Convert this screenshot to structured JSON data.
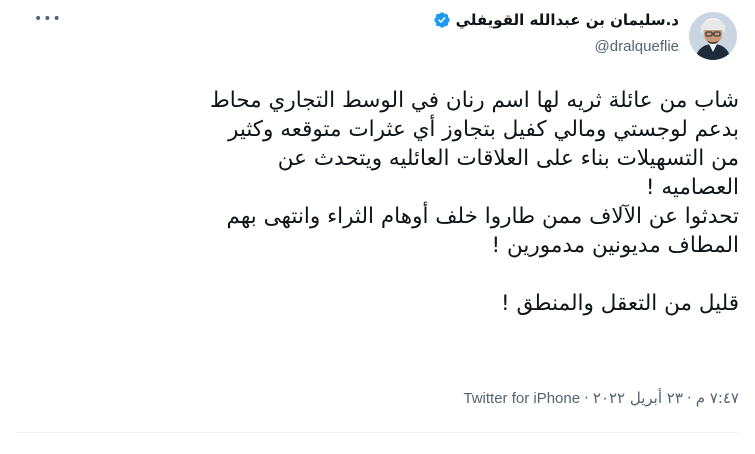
{
  "tweet": {
    "author": {
      "display_name": "د.سليمان بن عبدالله القويفلي",
      "handle": "@dralqueflie",
      "verified": true,
      "avatar_icon": "profile-photo",
      "verified_icon": "verified-badge-icon"
    },
    "more_icon": "•••",
    "text": "شاب  من عائلة ثريه لها اسم رنان في الوسط التجاري محاط\nبدعم لوجستي ومالي كفيل بتجاوز أي عثرات متوقعه وكثير\nمن التسهيلات بناء على العلاقات العائليه ويتحدث عن\nالعصاميه !\nتحدثوا عن الآلاف ممن طاروا خلف أوهام الثراء وانتهى بهم\nالمطاف مديونين مدمورين !\n\nقليل من التعقل والمنطق !",
    "meta": {
      "time": "٧:٤٧ م",
      "date": "٢٣ أبريل ٢٠٢٢",
      "separator": "·",
      "source": "Twitter for iPhone"
    }
  },
  "colors": {
    "text": "#0f1419",
    "muted": "#536471",
    "verified": "#1d9bf0",
    "divider": "#eff3f4"
  }
}
